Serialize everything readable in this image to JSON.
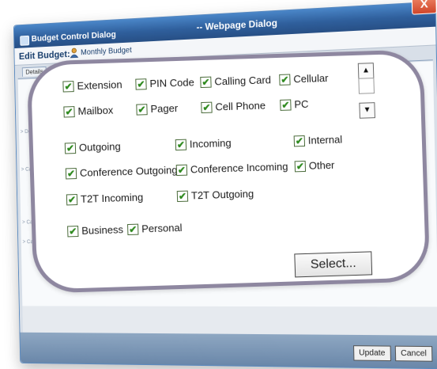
{
  "window": {
    "title": "Budget Control Dialog",
    "subtitle": "-- Webpage Dialog",
    "close_label": "X"
  },
  "edit": {
    "label": "Edit Budget:",
    "budget_name": "Monthly Budget",
    "person_icon": "user-icon"
  },
  "tabs": {
    "details": "Details"
  },
  "side": [
    "> Devi",
    "> Call",
    "> Call T",
    "> Call C"
  ],
  "callout": {
    "rows": [
      [
        "Extension",
        "PIN Code",
        "Calling Card",
        "Cellular"
      ],
      [
        "Mailbox",
        "Pager",
        "Cell Phone",
        "PC"
      ],
      [
        "Outgoing",
        "Incoming",
        "Internal"
      ],
      [
        "Conference Outgoing",
        "Conference Incoming",
        "Other"
      ],
      [
        "T2T Incoming",
        "T2T Outgoing"
      ],
      [
        "Business",
        "Personal"
      ]
    ],
    "check_glyph": "✔",
    "scroll_up": "▲",
    "scroll_down": "▼",
    "select_label": "Select..."
  },
  "footer": {
    "update_label": "Update",
    "cancel_label": "Cancel"
  }
}
